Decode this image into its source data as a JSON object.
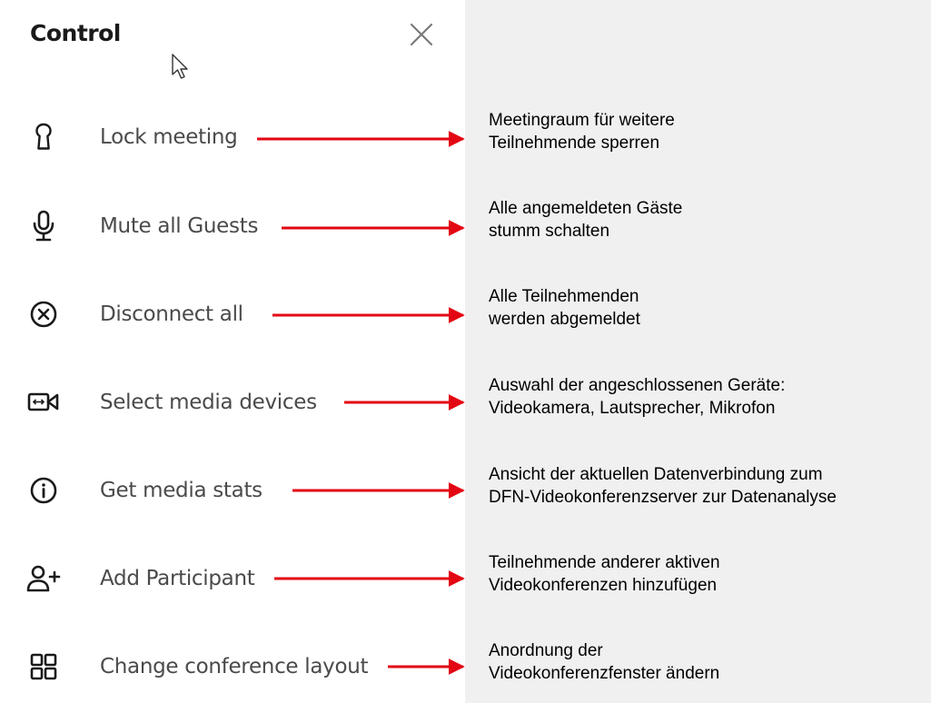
{
  "panel": {
    "title": "Control",
    "close_icon": "close-icon"
  },
  "menu": {
    "items": [
      {
        "label": "Lock meeting",
        "icon": "keyhole-lock-icon"
      },
      {
        "label": "Mute all Guests",
        "icon": "microphone-icon"
      },
      {
        "label": "Disconnect all",
        "icon": "circle-x-icon"
      },
      {
        "label": "Select media devices",
        "icon": "media-device-icon"
      },
      {
        "label": "Get media stats",
        "icon": "info-icon"
      },
      {
        "label": "Add Participant",
        "icon": "add-person-icon"
      },
      {
        "label": "Change conference layout",
        "icon": "grid-layout-icon"
      }
    ]
  },
  "annotations": [
    {
      "line1": "Meetingraum für weitere",
      "line2": "Teilnehmende sperren"
    },
    {
      "line1": "Alle angemeldeten Gäste",
      "line2": "stumm schalten"
    },
    {
      "line1": "Alle Teilnehmenden",
      "line2": "werden abgemeldet"
    },
    {
      "line1": "Auswahl der angeschlossenen Geräte:",
      "line2": "Videokamera, Lautsprecher, Mikrofon"
    },
    {
      "line1": "Ansicht der aktuellen Datenverbindung zum",
      "line2": "DFN-Videokonferenzserver zur Datenanalyse"
    },
    {
      "line1": "Teilnehmende anderer aktiven",
      "line2": "Videokonferenzen hinzufügen"
    },
    {
      "line1": "Anordnung der",
      "line2": "Videokonferenzfenster ändern"
    }
  ],
  "colors": {
    "arrow": "#e30613",
    "label": "#4a4a4a",
    "title": "#1a1a1a",
    "background": "#f0f0f0",
    "panel": "#ffffff"
  }
}
